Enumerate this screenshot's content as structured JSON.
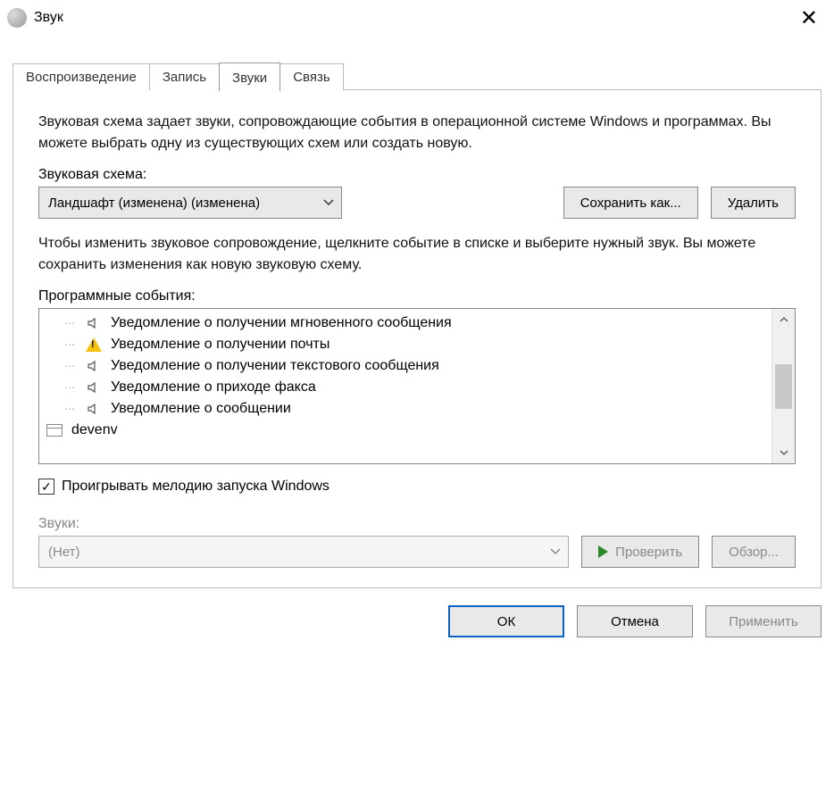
{
  "window": {
    "title": "Звук"
  },
  "tabs": {
    "playback": "Воспроизведение",
    "recording": "Запись",
    "sounds": "Звуки",
    "communications": "Связь"
  },
  "panel": {
    "description": "Звуковая схема задает звуки, сопровождающие события в операционной системе Windows и программах. Вы можете выбрать одну из существующих схем или создать новую.",
    "scheme_label": "Звуковая схема:",
    "scheme_value": "Ландшафт (изменена) (изменена)",
    "save_as": "Сохранить как...",
    "delete": "Удалить",
    "events_desc": "Чтобы изменить звуковое сопровождение, щелкните событие в списке и выберите нужный звук. Вы можете сохранить изменения как новую звуковую схему.",
    "events_label": "Программные события:",
    "events": [
      {
        "icon": "speaker",
        "label": "Уведомление о получении мгновенного сообщения"
      },
      {
        "icon": "warning",
        "label": "Уведомление о получении почты"
      },
      {
        "icon": "speaker",
        "label": "Уведомление о получении текстового сообщения"
      },
      {
        "icon": "speaker",
        "label": "Уведомление о приходе факса"
      },
      {
        "icon": "speaker",
        "label": "Уведомление о сообщении"
      },
      {
        "icon": "window",
        "label": "devenv"
      }
    ],
    "startup_checkbox": "Проигрывать мелодию запуска Windows",
    "startup_checked": true,
    "sounds_label": "Звуки:",
    "sounds_value": "(Нет)",
    "test_btn": "Проверить",
    "browse_btn": "Обзор..."
  },
  "footer": {
    "ok": "ОК",
    "cancel": "Отмена",
    "apply": "Применить"
  }
}
